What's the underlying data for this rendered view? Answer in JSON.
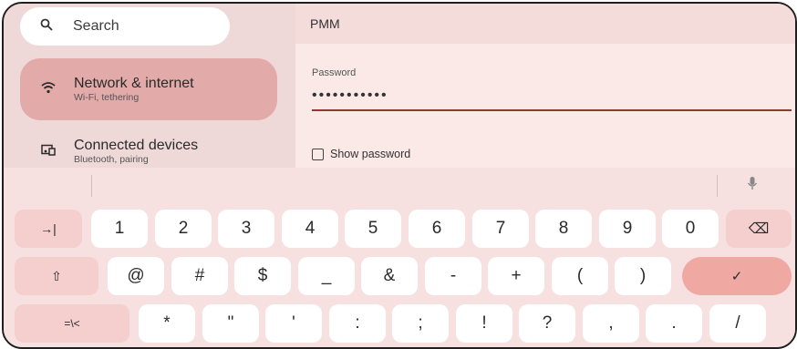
{
  "search": {
    "icon": "search-icon",
    "label": "Search"
  },
  "sidebar": {
    "items": [
      {
        "icon": "wifi-icon",
        "title": "Network & internet",
        "subtitle": "Wi-Fi, tethering"
      },
      {
        "icon": "devices-icon",
        "title": "Connected devices",
        "subtitle": "Bluetooth, pairing"
      }
    ]
  },
  "dialog": {
    "title": "PMM",
    "password_label": "Password",
    "password_value": "•••••••••••",
    "show_password_label": "Show password"
  },
  "keyboard": {
    "mic_icon": "microphone-icon",
    "row1": {
      "tab": "→|",
      "keys": [
        "1",
        "2",
        "3",
        "4",
        "5",
        "6",
        "7",
        "8",
        "9",
        "0"
      ],
      "backspace": "⌫"
    },
    "row2": {
      "shift": "⇧",
      "keys": [
        "@",
        "#",
        "$",
        "_",
        "&",
        "-",
        "+",
        "(",
        ")"
      ],
      "enter": "✓"
    },
    "row3": {
      "mode": "=\\<",
      "keys": [
        "*",
        "\"",
        "'",
        ":",
        ";",
        "!",
        "?",
        ",",
        ".",
        "/"
      ]
    }
  },
  "colors": {
    "accent": "#f0a8a3",
    "selected_nav": "#e2aaa9",
    "underline": "#8e3a34"
  }
}
